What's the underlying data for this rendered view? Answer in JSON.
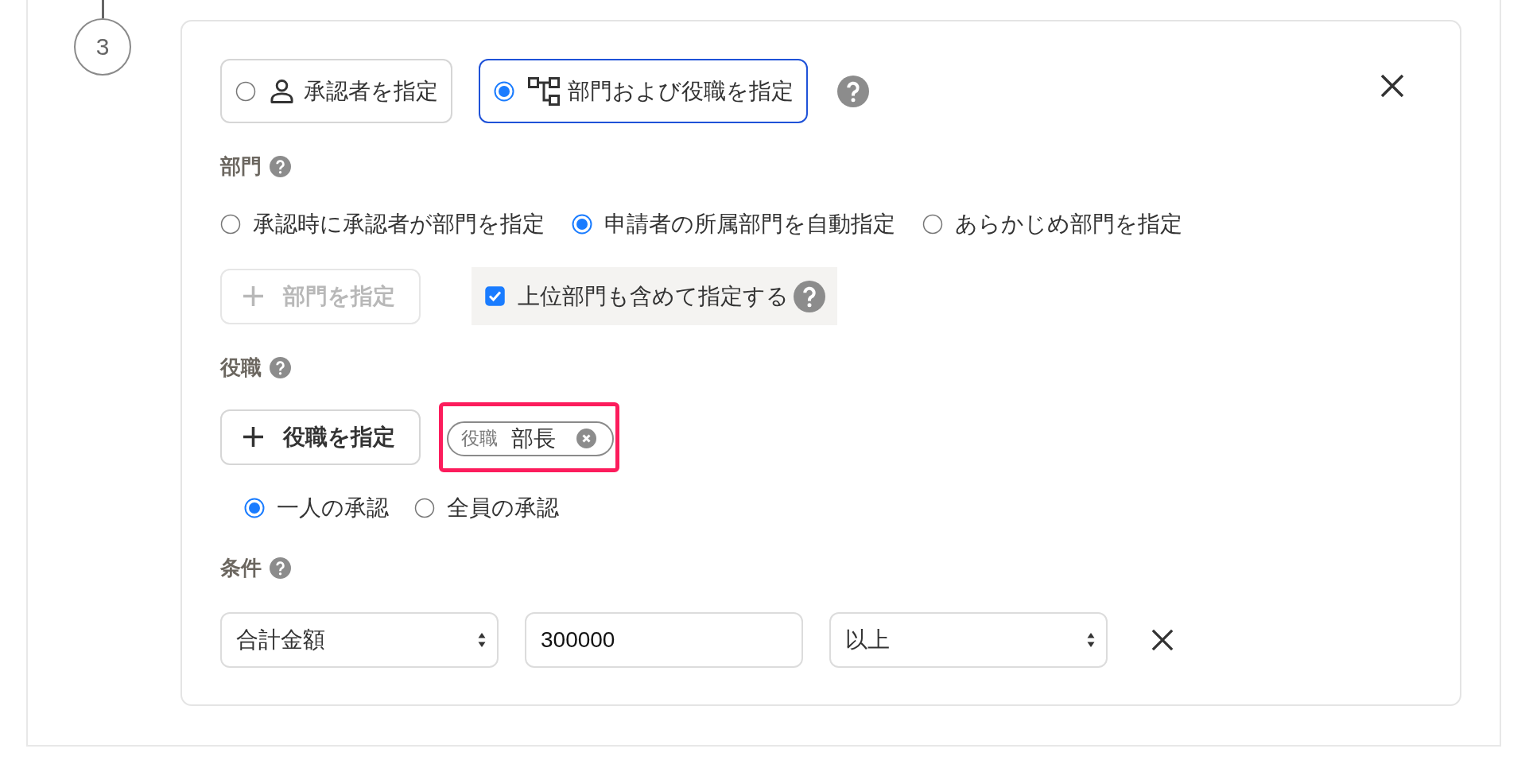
{
  "step": {
    "number": "3"
  },
  "approver_modes": [
    {
      "kind": "approver",
      "label": "承認者を指定",
      "selected": false
    },
    {
      "kind": "department_position",
      "label": "部門および役職を指定",
      "selected": true
    }
  ],
  "department": {
    "label": "部門",
    "options": [
      {
        "label": "承認時に承認者が部門を指定",
        "selected": false
      },
      {
        "label": "申請者の所属部門を自動指定",
        "selected": true
      },
      {
        "label": "あらかじめ部門を指定",
        "selected": false
      }
    ],
    "add_button": {
      "label": "部門を指定",
      "disabled": true
    },
    "include_parent": {
      "label": "上位部門も含めて指定する",
      "checked": true
    }
  },
  "position": {
    "label": "役職",
    "add_button": {
      "label": "役職を指定",
      "disabled": false
    },
    "tags": [
      {
        "category": "役職",
        "value": "部長",
        "highlighted": true
      }
    ],
    "approval_options": [
      {
        "label": "一人の承認",
        "selected": true
      },
      {
        "label": "全員の承認",
        "selected": false
      }
    ]
  },
  "conditions": {
    "label": "条件",
    "rows": [
      {
        "field": "合計金額",
        "amount": "300000",
        "comparison": "以上"
      }
    ]
  }
}
